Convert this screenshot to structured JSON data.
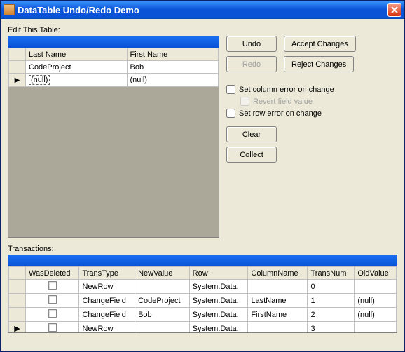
{
  "window": {
    "title": "DataTable Undo/Redo Demo"
  },
  "labels": {
    "edit_this_table": "Edit This Table:",
    "transactions": "Transactions:"
  },
  "top_grid": {
    "columns": [
      "Last Name",
      "First Name"
    ],
    "rows": [
      {
        "indicator": "",
        "last_name": "CodeProject",
        "first_name": "Bob",
        "last_null": false,
        "first_null": false,
        "selected": false
      },
      {
        "indicator": "▶",
        "last_name": "(null)",
        "first_name": "(null)",
        "last_null": true,
        "first_null": true,
        "selected": true
      }
    ]
  },
  "buttons": {
    "undo": "Undo",
    "redo": "Redo",
    "accept": "Accept Changes",
    "reject": "Reject Changes",
    "clear": "Clear",
    "collect": "Collect"
  },
  "checks": {
    "col_error": "Set column error on change",
    "revert": "Revert field value",
    "row_error": "Set row error on change"
  },
  "trans_grid": {
    "columns": [
      "WasDeleted",
      "TransType",
      "NewValue",
      "Row",
      "ColumnName",
      "TransNum",
      "OldValue"
    ],
    "rows": [
      {
        "indicator": "",
        "was_deleted": false,
        "trans_type": "NewRow",
        "new_value": "",
        "row": "System.Data.",
        "column_name": "",
        "trans_num": "0",
        "old_value": ""
      },
      {
        "indicator": "",
        "was_deleted": false,
        "trans_type": "ChangeField",
        "new_value": "CodeProject",
        "row": "System.Data.",
        "column_name": "LastName",
        "trans_num": "1",
        "old_value": "(null)"
      },
      {
        "indicator": "",
        "was_deleted": false,
        "trans_type": "ChangeField",
        "new_value": "Bob",
        "row": "System.Data.",
        "column_name": "FirstName",
        "trans_num": "2",
        "old_value": "(null)"
      },
      {
        "indicator": "▶",
        "was_deleted": false,
        "trans_type": "NewRow",
        "new_value": "",
        "row": "System.Data.",
        "column_name": "",
        "trans_num": "3",
        "old_value": ""
      }
    ]
  }
}
